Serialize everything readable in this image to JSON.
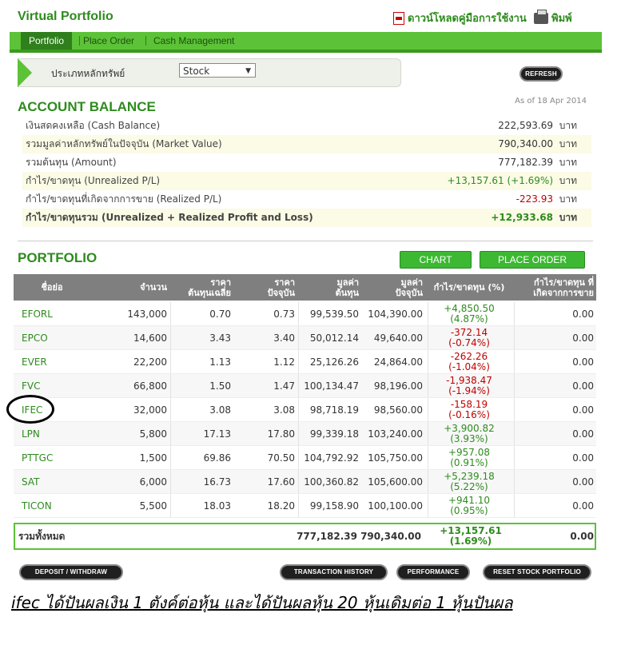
{
  "header": {
    "title": "Virtual Portfolio",
    "download_label": "ดาวน์โหลดคู่มือการใช้งาน",
    "print_label": "พิมพ์"
  },
  "tabs": [
    "Portfolio",
    "Place Order",
    "Cash Management"
  ],
  "security_type": {
    "label": "ประเภทหลักทรัพย์",
    "selected": "Stock"
  },
  "refresh_label": "REFRESH",
  "account": {
    "title": "ACCOUNT BALANCE",
    "as_of": "As of 18 Apr 2014",
    "unit": "บาท",
    "rows": [
      {
        "label": "เงินสดคงเหลือ (Cash Balance)",
        "value": "222,593.69"
      },
      {
        "label": "รวมมูลค่าหลักทรัพย์ในปัจจุบัน (Market Value)",
        "value": "790,340.00"
      },
      {
        "label": "รวมต้นทุน (Amount)",
        "value": "777,182.39"
      },
      {
        "label": "กำไร/ขาดทุน (Unrealized P/L)",
        "value": "+13,157.61 (+1.69%)"
      },
      {
        "label": "กำไร/ขาดทุนที่เกิดจากการขาย (Realized P/L)",
        "value": "-223.93"
      },
      {
        "label": "กำไร/ขาดทุนรวม (Unrealized + Realized Profit and Loss)",
        "value": "+12,933.68"
      }
    ]
  },
  "portfolio": {
    "title": "PORTFOLIO",
    "chart_label": "CHART",
    "place_order_label": "PLACE ORDER",
    "headers": {
      "symbol": "ชื่อย่อ",
      "volume": "จำนวน",
      "avg_cost_1": "ราคา",
      "avg_cost_2": "ต้นทุนเฉลี่ย",
      "price_1": "ราคา",
      "price_2": "ปัจจุบัน",
      "cost_1": "มูลค่า",
      "cost_2": "ต้นทุน",
      "mv_1": "มูลค่า",
      "mv_2": "ปัจจุบัน",
      "pl": "กำไร/ขาดทุน (%)",
      "rpl_1": "กำไร/ขาดทุน ที่",
      "rpl_2": "เกิดจากการขาย"
    },
    "rows": [
      {
        "symbol": "EFORL",
        "volume": "143,000",
        "avg": "0.70",
        "price": "0.73",
        "cost": "99,539.50",
        "mv": "104,390.00",
        "pl": "+4,850.50",
        "pct": "(4.87%)",
        "rpl": "0.00"
      },
      {
        "symbol": "EPCO",
        "volume": "14,600",
        "avg": "3.43",
        "price": "3.40",
        "cost": "50,012.14",
        "mv": "49,640.00",
        "pl": "-372.14",
        "pct": "(-0.74%)",
        "rpl": "0.00"
      },
      {
        "symbol": "EVER",
        "volume": "22,200",
        "avg": "1.13",
        "price": "1.12",
        "cost": "25,126.26",
        "mv": "24,864.00",
        "pl": "-262.26",
        "pct": "(-1.04%)",
        "rpl": "0.00"
      },
      {
        "symbol": "FVC",
        "volume": "66,800",
        "avg": "1.50",
        "price": "1.47",
        "cost": "100,134.47",
        "mv": "98,196.00",
        "pl": "-1,938.47",
        "pct": "(-1.94%)",
        "rpl": "0.00"
      },
      {
        "symbol": "IFEC",
        "volume": "32,000",
        "avg": "3.08",
        "price": "3.08",
        "cost": "98,718.19",
        "mv": "98,560.00",
        "pl": "-158.19",
        "pct": "(-0.16%)",
        "rpl": "0.00"
      },
      {
        "symbol": "LPN",
        "volume": "5,800",
        "avg": "17.13",
        "price": "17.80",
        "cost": "99,339.18",
        "mv": "103,240.00",
        "pl": "+3,900.82",
        "pct": "(3.93%)",
        "rpl": "0.00"
      },
      {
        "symbol": "PTTGC",
        "volume": "1,500",
        "avg": "69.86",
        "price": "70.50",
        "cost": "104,792.92",
        "mv": "105,750.00",
        "pl": "+957.08",
        "pct": "(0.91%)",
        "rpl": "0.00"
      },
      {
        "symbol": "SAT",
        "volume": "6,000",
        "avg": "16.73",
        "price": "17.60",
        "cost": "100,360.82",
        "mv": "105,600.00",
        "pl": "+5,239.18",
        "pct": "(5.22%)",
        "rpl": "0.00"
      },
      {
        "symbol": "TICON",
        "volume": "5,500",
        "avg": "18.03",
        "price": "18.20",
        "cost": "99,158.90",
        "mv": "100,100.00",
        "pl": "+941.10",
        "pct": "(0.95%)",
        "rpl": "0.00"
      }
    ],
    "total": {
      "label": "รวมทั้งหมด",
      "cost": "777,182.39",
      "mv": "790,340.00",
      "pl": "+13,157.61",
      "pct": "(1.69%)",
      "rpl": "0.00"
    }
  },
  "buttons": {
    "deposit": "DEPOSIT / WITHDRAW",
    "history": "TRANSACTION HISTORY",
    "performance": "PERFORMANCE",
    "reset": "RESET STOCK PORTFOLIO"
  },
  "note": "ifec ได้ปันผลเงิน 1 ตังค์ต่อหุ้น และได้ปันผลหุ้น 20 หุ้นเดิมต่อ 1 หุ้นปันผล",
  "colors": {
    "brand_green": "#2e8b1e",
    "tab_green": "#5cc237",
    "negative": "#c00000",
    "header_gray": "#7f7f7f"
  }
}
